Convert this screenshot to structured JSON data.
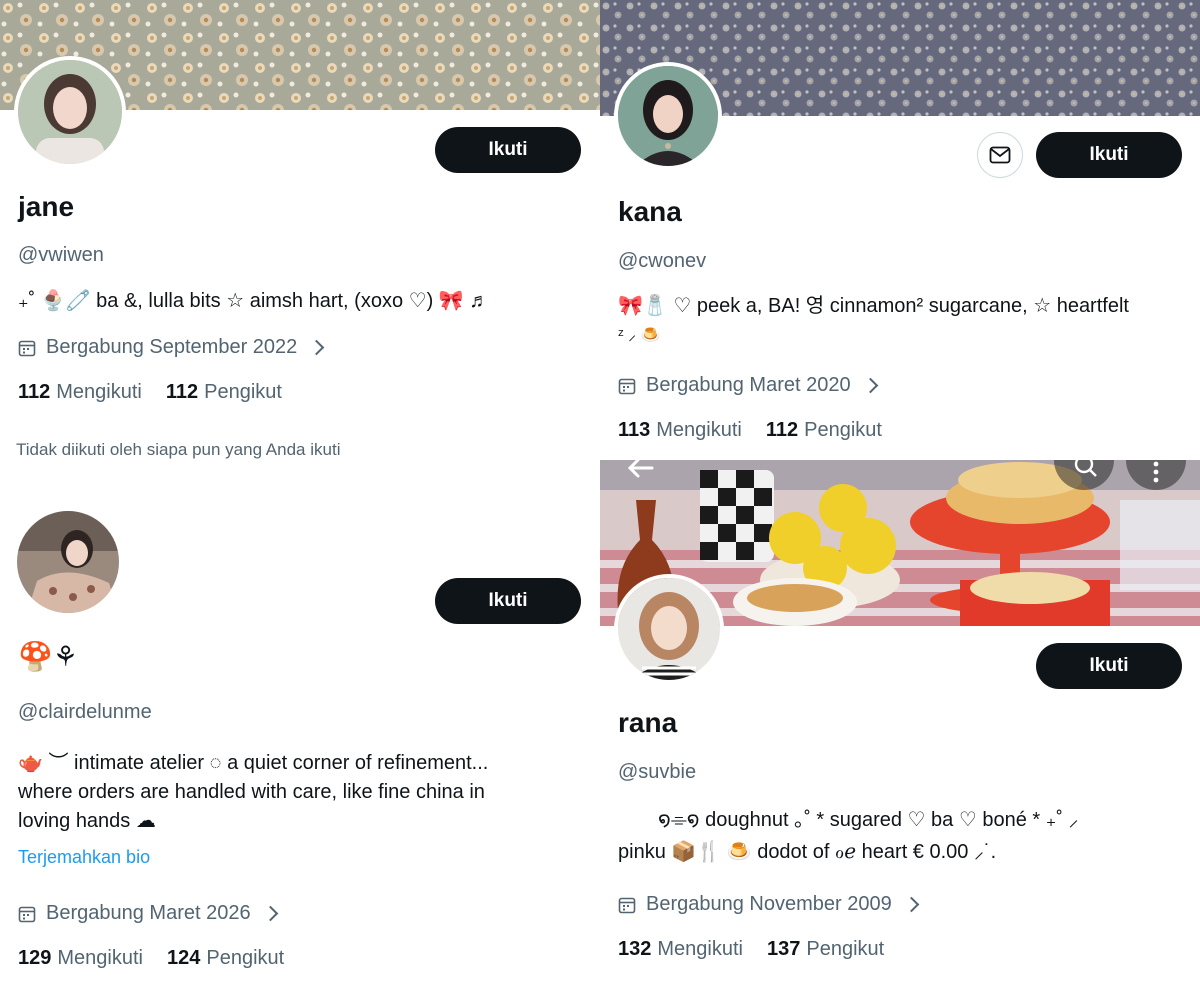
{
  "follow_label": "Ikuti",
  "profiles": [
    {
      "name": "jane",
      "handle": "@vwiwen",
      "bio": "₊˚ 🍨🧷 ba &, lulla bits ☆ aimsh hart, (xoxo ♡) 🎀 ♬",
      "joined": "Bergabung September 2022",
      "following_count": "112",
      "following_label": "Mengikuti",
      "followers_count": "112",
      "followers_label": "Pengikut",
      "followed_by_note": "Tidak diikuti oleh siapa pun yang Anda ikuti"
    },
    {
      "name": "🍄⚘",
      "handle": "@clairdelunme",
      "bio_line1": "🫖 ︶ intimate atelier ◌ a quiet corner of refinement...",
      "bio_line2": "where orders are handled with care, like fine china in",
      "bio_line3": "loving hands ☁",
      "translate_label": "Terjemahkan bio",
      "joined": "Bergabung Maret 2026",
      "following_count": "129",
      "following_label": "Mengikuti",
      "followers_count": "124",
      "followers_label": "Pengikut"
    },
    {
      "name": "kana",
      "handle": "@cwonev",
      "bio_line1": "🎀🧂 ♡ peek a, BA! 영 cinnamon² sugarcane, ☆ heartfelt",
      "bio_line2": "ᶻ ⸝ 🍮",
      "joined": "Bergabung Maret 2020",
      "following_count": "113",
      "following_label": "Mengikuti",
      "followers_count": "112",
      "followers_label": "Pengikut"
    },
    {
      "name": "rana",
      "handle": "@suvbie",
      "bio_line1": "໑⌯໑   doughnut ｡˚ * sugared    ♡ ba ♡ boné * ₊˚ ⸝",
      "bio_line2": "pinku 📦🍴    🍮 dodot of ℴℯ heart € 0.00 ⸝˙.",
      "joined": "Bergabung November 2009",
      "following_count": "132",
      "following_label": "Mengikuti",
      "followers_count": "137",
      "followers_label": "Pengikut"
    }
  ],
  "icons": {
    "calendar": "calendar-icon",
    "mail": "mail-icon",
    "back": "back-arrow-icon",
    "search": "search-icon",
    "more": "more-icon",
    "chevron": "chevron-right-icon"
  }
}
